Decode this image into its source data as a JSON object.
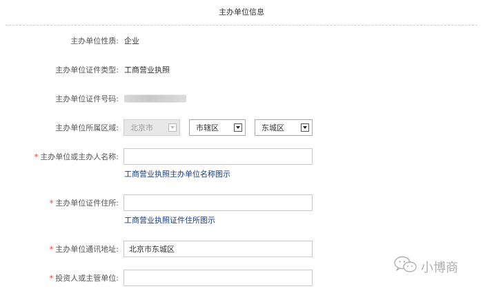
{
  "section_title": "主办单位信息",
  "fields": {
    "nature": {
      "label": "主办单位性质:",
      "value": "企业"
    },
    "cert_type": {
      "label": "主办单位证件类型:",
      "value": "工商营业执照"
    },
    "cert_no": {
      "label": "主办单位证件号码:"
    },
    "region": {
      "label": "主办单位所属区域:",
      "province": "北京市",
      "city": "市辖区",
      "district": "东城区"
    },
    "org_name": {
      "required_mark": "*",
      "label": "主办单位或主办人名称:",
      "value": "",
      "hint": "工商营业执照主办单位名称图示"
    },
    "cert_address": {
      "required_mark": "*",
      "label": "主办单位证件住所:",
      "value": "",
      "hint": "工商营业执照证件住所图示"
    },
    "mail_address": {
      "required_mark": "*",
      "label": "主办单位通讯地址:",
      "value": "北京市东城区"
    },
    "investor": {
      "required_mark": "*",
      "label": "投资人或主管单位:",
      "value": ""
    }
  },
  "watermark": {
    "text": "小博商",
    "icon": "wechat-logo-icon"
  },
  "colors": {
    "hint_link": "#1a3e8a",
    "required": "#e33333",
    "divider": "#cfcfcf"
  }
}
